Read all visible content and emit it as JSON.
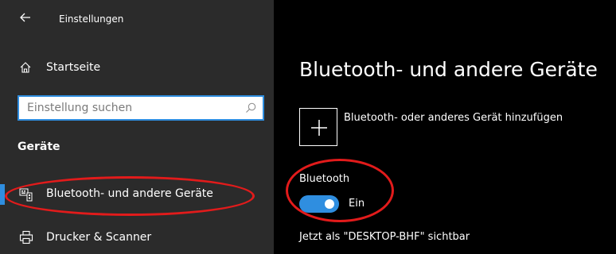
{
  "window": {
    "title": "Einstellungen"
  },
  "sidebar": {
    "home_label": "Startseite",
    "search_placeholder": "Einstellung suchen",
    "section_title": "Geräte",
    "items": [
      {
        "label": "Bluetooth- und andere Geräte",
        "icon": "keyboard-device-icon",
        "selected": true
      },
      {
        "label": "Drucker & Scanner",
        "icon": "printer-icon",
        "selected": false
      }
    ]
  },
  "main": {
    "page_title": "Bluetooth- und andere Geräte",
    "add_device_label": "Bluetooth- oder anderes Gerät hinzufügen",
    "bluetooth_label": "Bluetooth",
    "toggle_state": "Ein",
    "toggle_on": true,
    "visible_as_text": "Jetzt als \"DESKTOP-BHF\" sichtbar"
  },
  "colors": {
    "accent": "#2f8ee0",
    "annotation": "#e21b1b",
    "sidebar_bg": "#2b2b2b",
    "main_bg": "#000000"
  }
}
